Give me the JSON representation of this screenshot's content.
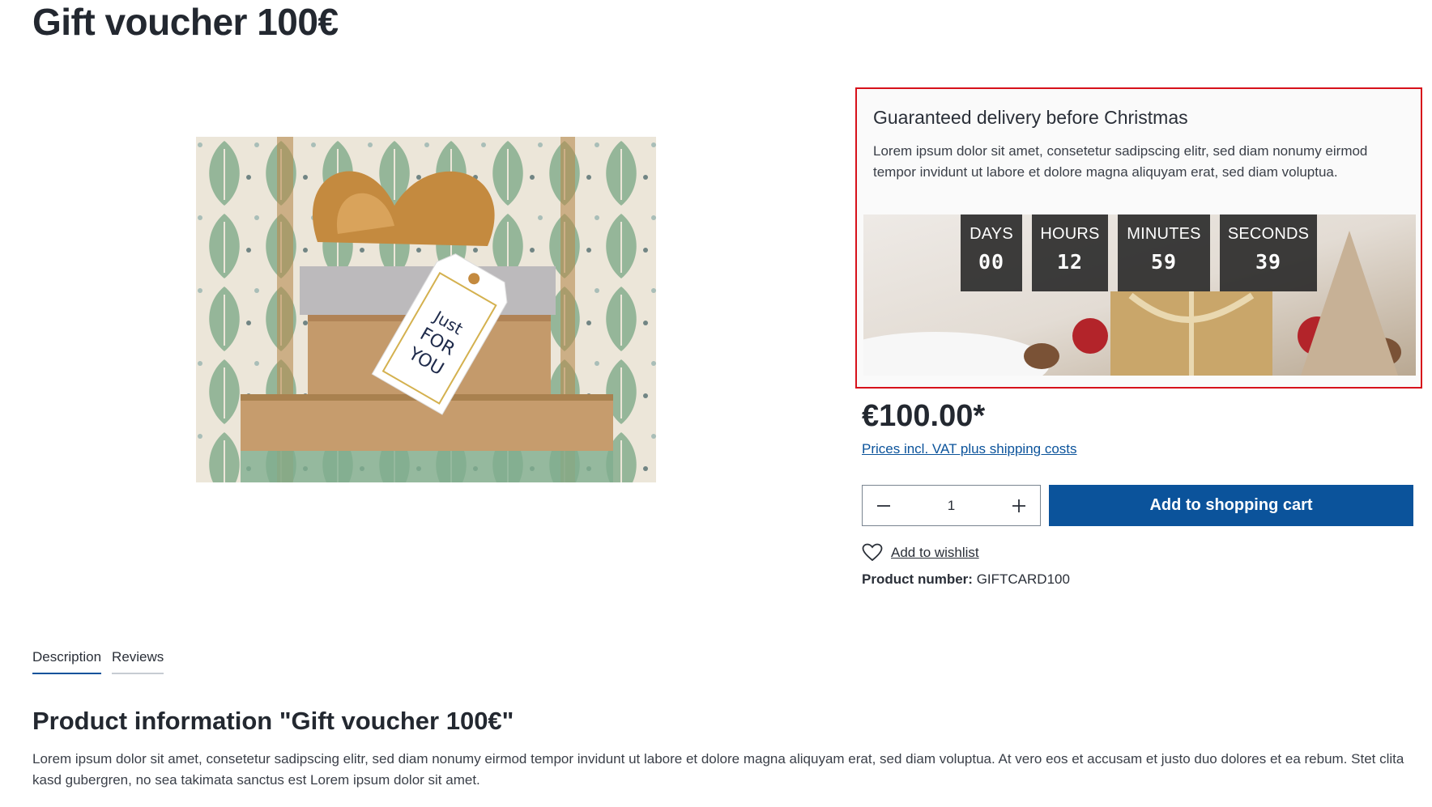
{
  "product": {
    "title": "Gift voucher 100€",
    "image_alt": "Just for you gift boxes",
    "tag_lettering": "Just FOR YOU"
  },
  "promo": {
    "title": "Guaranteed delivery before Christmas",
    "text": "Lorem ipsum dolor sit amet, consetetur sadipscing elitr, sed diam nonumy eirmod tempor invidunt ut labore et dolore magna aliquyam erat, sed diam voluptua.",
    "countdown": [
      {
        "label": "DAYS",
        "value": "00"
      },
      {
        "label": "HOURS",
        "value": "12"
      },
      {
        "label": "MINUTES",
        "value": "59"
      },
      {
        "label": "SECONDS",
        "value": "39"
      }
    ],
    "border_color": "#d7111b"
  },
  "buy": {
    "price": "€100.00*",
    "price_note": "Prices incl. VAT plus shipping costs",
    "quantity": "1",
    "add_to_cart": "Add to shopping cart",
    "wishlist": "Add to wishlist",
    "product_number_label": "Product number:",
    "product_number_value": "GIFTCARD100",
    "accent_color": "#0b539b"
  },
  "tabs": [
    {
      "label": "Description",
      "active": true
    },
    {
      "label": "Reviews",
      "active": false
    }
  ],
  "info": {
    "title": "Product information \"Gift voucher 100€\"",
    "text": "Lorem ipsum dolor sit amet, consetetur sadipscing elitr, sed diam nonumy eirmod tempor invidunt ut labore et dolore magna aliquyam erat, sed diam voluptua. At vero eos et accusam et justo duo dolores et ea rebum. Stet clita kasd gubergren, no sea takimata sanctus est Lorem ipsum dolor sit amet."
  },
  "icons": {
    "minus": "minus-icon",
    "plus": "plus-icon",
    "wishlist": "heart-icon"
  }
}
